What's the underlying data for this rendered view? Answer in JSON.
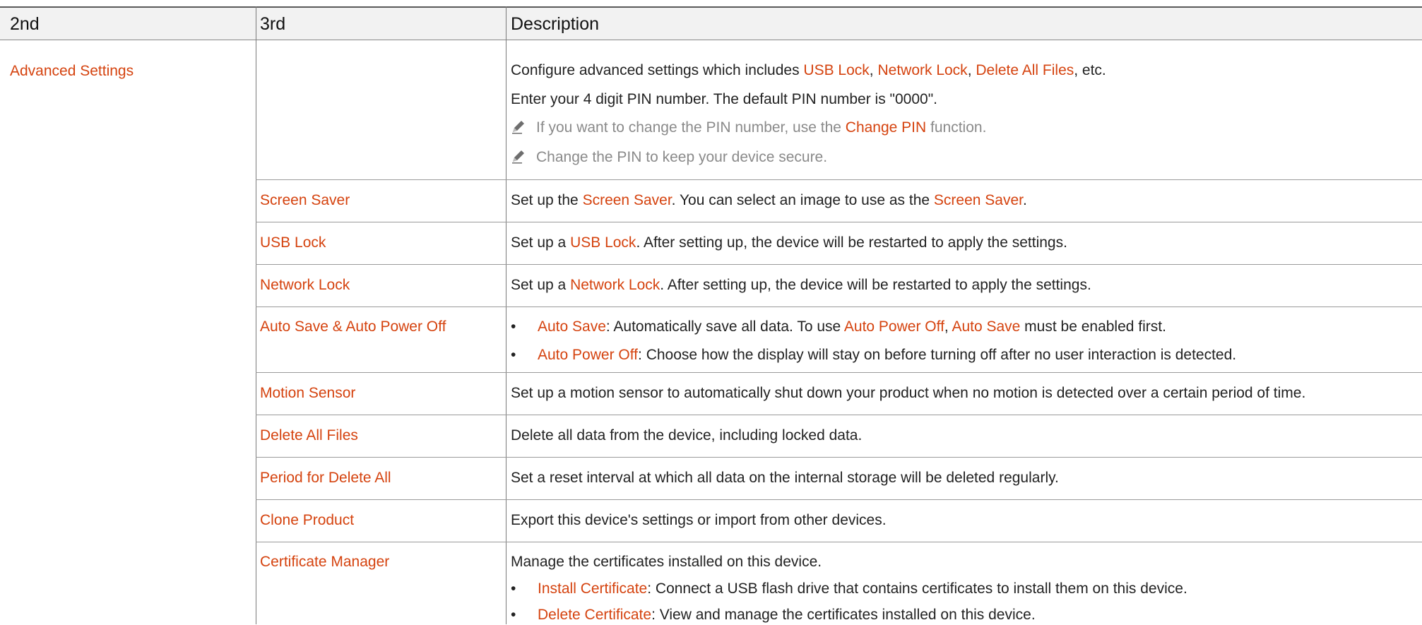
{
  "header": {
    "col1": "2nd",
    "col2": "3rd",
    "col3": "Description"
  },
  "advanced": {
    "label": "Advanced Settings",
    "d1": {
      "a": "Configure advanced settings which includes ",
      "b": "USB Lock",
      "c": ", ",
      "d": "Network Lock",
      "e": ", ",
      "f": "Delete All Files",
      "g": ", etc."
    },
    "d2": "Enter your 4 digit PIN number. The default PIN number is \"0000\".",
    "n1": {
      "a": "If you want to change the PIN number, use the ",
      "b": "Change PIN",
      "c": " function."
    },
    "n2": "Change the PIN to keep your device secure."
  },
  "rows": {
    "screen_saver": {
      "label": "Screen Saver",
      "a": "Set up the ",
      "b": "Screen Saver",
      "c": ". You can select an image to use as the ",
      "d": "Screen Saver",
      "e": "."
    },
    "usb_lock": {
      "label": "USB Lock",
      "a": "Set up a ",
      "b": "USB Lock",
      "c": ". After setting up, the device will be restarted to apply the settings."
    },
    "network_lock": {
      "label": "Network Lock",
      "a": "Set up a ",
      "b": "Network Lock",
      "c": ". After setting up, the device will be restarted to apply the settings."
    },
    "auto_save": {
      "label": "Auto Save & Auto Power Off",
      "b1": {
        "a": "Auto Save",
        "b": ": Automatically save all data. To use ",
        "c": "Auto Power Off",
        "d": ", ",
        "e": "Auto Save",
        "f": " must be enabled first."
      },
      "b2": {
        "a": "Auto Power Off",
        "b": ": Choose how the display will stay on before turning off after no user interaction is detected."
      }
    },
    "motion_sensor": {
      "label": "Motion Sensor",
      "desc": "Set up a motion sensor to automatically shut down your product when no motion is detected over a certain period of time."
    },
    "delete_all": {
      "label": "Delete All Files",
      "desc": "Delete all data from the device, including locked data."
    },
    "period_delete": {
      "label": "Period for Delete All",
      "desc": "Set a reset interval at which all data on the internal storage will be deleted regularly."
    },
    "clone": {
      "label": "Clone Product",
      "desc": "Export this device's settings or import from other devices."
    },
    "cert": {
      "label": "Certificate Manager",
      "desc": "Manage the certificates installed on this device.",
      "b1": {
        "a": "Install Certificate",
        "b": ": Connect a USB flash drive that contains certificates to install them on this device."
      },
      "b2": {
        "a": "Delete Certificate",
        "b": ": View and manage the certificates installed on this device."
      }
    }
  },
  "bullet_char": "•",
  "colors": {
    "highlight": "#d5430f",
    "note": "#8a8a8a",
    "header_bg": "#f2f2f2"
  }
}
